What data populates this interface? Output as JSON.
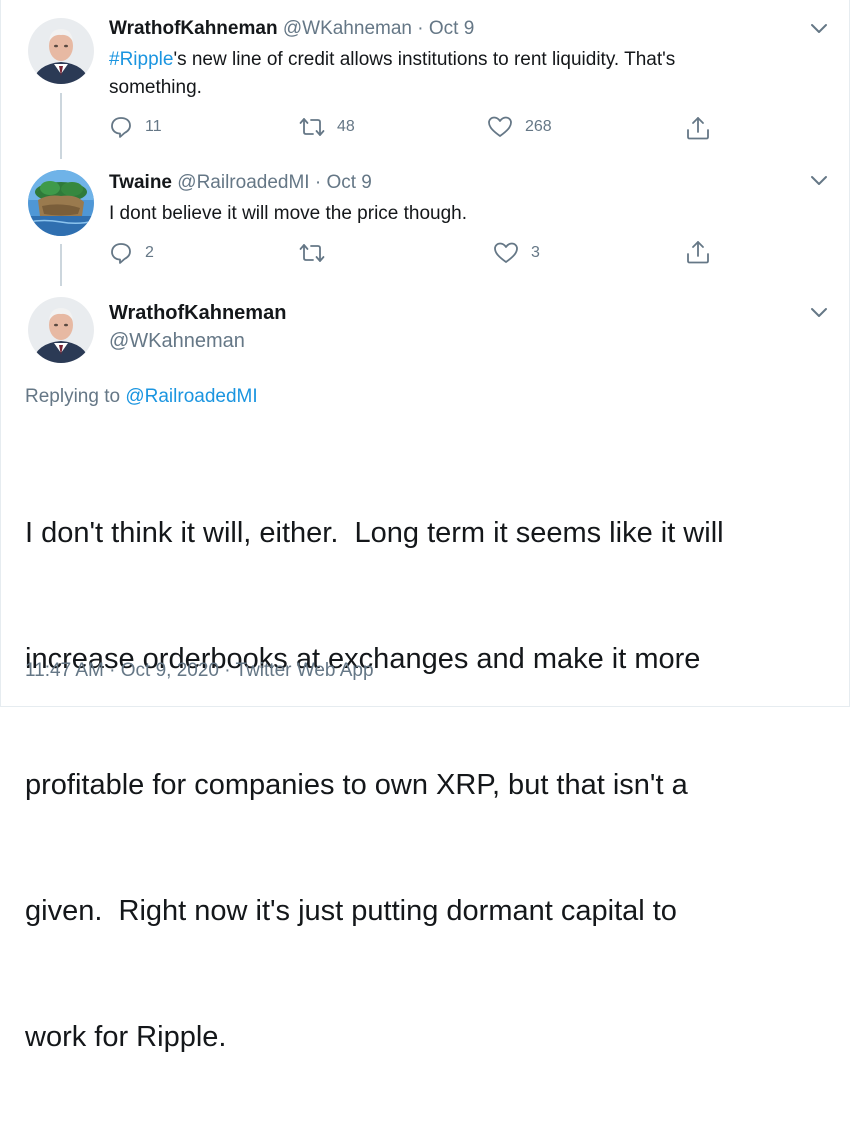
{
  "colors": {
    "text": "#14171a",
    "secondary": "#657786",
    "link": "#1b95e0",
    "thread_line": "#ccd6dd"
  },
  "tweet1": {
    "name": "WrathofKahneman",
    "handle": "@WKahneman",
    "separator": " · ",
    "date": "Oct 9",
    "hashtag": "#Ripple",
    "text_line1_rest": "'s new line of credit allows institutions to rent liquidity. That's",
    "text_line2": "something.",
    "replies": "11",
    "retweets": "48",
    "likes": "268",
    "icons": [
      "reply-icon",
      "retweet-icon",
      "like-icon",
      "share-icon",
      "chevron-down-icon"
    ]
  },
  "tweet2": {
    "name": "Twaine",
    "handle": "@RailroadedMI",
    "separator": " · ",
    "date": "Oct 9",
    "text": "I dont believe it will move the price though.",
    "replies": "2",
    "retweets": "",
    "likes": "3",
    "icons": [
      "reply-icon",
      "retweet-icon",
      "like-icon",
      "share-icon",
      "chevron-down-icon"
    ]
  },
  "main_tweet": {
    "name": "WrathofKahneman",
    "handle": "@WKahneman",
    "replying_prefix": "Replying to ",
    "replying_to": "@RailroadedMI",
    "text_lines": [
      "I don't think it will, either.  Long term it seems like it will",
      "increase orderbooks at exchanges and make it more",
      "profitable for companies to own XRP, but that isn't a",
      "given.  Right now it's just putting dormant capital to",
      "work for Ripple."
    ],
    "timestamp": "11:47 AM · Oct 9, 2020 · Twitter Web App"
  }
}
